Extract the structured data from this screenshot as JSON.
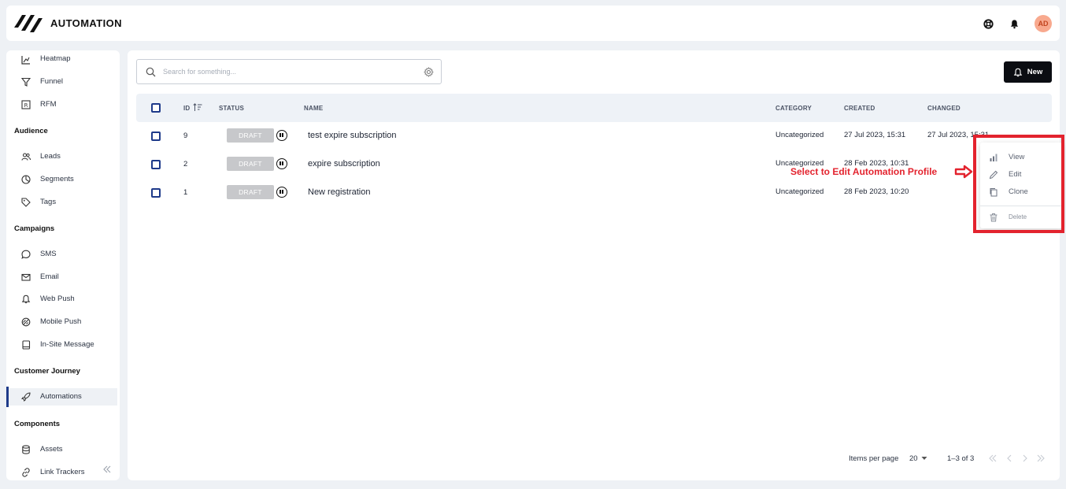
{
  "header": {
    "app_title": "AUTOMATION",
    "avatar_initials": "AD",
    "icons": [
      "lifebuoy-icon",
      "bell-icon"
    ]
  },
  "sidebar": {
    "items_top": [
      {
        "label": "Heatmap",
        "icon": "chart-icon"
      },
      {
        "label": "Funnel",
        "icon": "funnel-icon"
      },
      {
        "label": "RFM",
        "icon": "rfm-icon"
      }
    ],
    "sections": [
      {
        "title": "Audience",
        "items": [
          {
            "label": "Leads",
            "icon": "users-icon"
          },
          {
            "label": "Segments",
            "icon": "pie-icon"
          },
          {
            "label": "Tags",
            "icon": "tag-icon"
          }
        ]
      },
      {
        "title": "Campaigns",
        "items": [
          {
            "label": "SMS",
            "icon": "chat-icon"
          },
          {
            "label": "Email",
            "icon": "mail-icon"
          },
          {
            "label": "Web Push",
            "icon": "bell-icon"
          },
          {
            "label": "Mobile Push",
            "icon": "mobile-push-icon"
          },
          {
            "label": "In-Site Message",
            "icon": "book-icon"
          }
        ]
      },
      {
        "title": "Customer Journey",
        "items": [
          {
            "label": "Automations",
            "icon": "rocket-icon",
            "active": true
          }
        ]
      },
      {
        "title": "Components",
        "items": [
          {
            "label": "Assets",
            "icon": "database-icon"
          },
          {
            "label": "Link Trackers",
            "icon": "link-icon"
          }
        ]
      }
    ]
  },
  "toolbar": {
    "search_placeholder": "Search for something...",
    "new_label": "New"
  },
  "table": {
    "columns": [
      "ID",
      "STATUS",
      "NAME",
      "CATEGORY",
      "CREATED",
      "CHANGED"
    ],
    "rows": [
      {
        "id": "9",
        "status": "DRAFT",
        "name": "test expire subscription",
        "category": "Uncategorized",
        "created": "27 Jul 2023, 15:31",
        "changed": "27 Jul 2023, 15:31"
      },
      {
        "id": "2",
        "status": "DRAFT",
        "name": "expire subscription",
        "category": "Uncategorized",
        "created": "28 Feb 2023, 10:31",
        "changed": ""
      },
      {
        "id": "1",
        "status": "DRAFT",
        "name": "New registration",
        "category": "Uncategorized",
        "created": "28 Feb 2023, 10:20",
        "changed": ""
      }
    ]
  },
  "pagination": {
    "items_per_page_label": "Items per page",
    "items_per_page_value": "20",
    "range": "1–3 of 3"
  },
  "context_menu": {
    "items": [
      {
        "label": "View",
        "icon": "bar-chart-icon"
      },
      {
        "label": "Edit",
        "icon": "pencil-icon"
      },
      {
        "label": "Clone",
        "icon": "copy-icon"
      },
      {
        "label": "Delete",
        "icon": "trash-icon"
      }
    ]
  },
  "annotation": {
    "text": "Select to Edit Automation Profile",
    "color": "#e3232e"
  },
  "colors": {
    "accent": "#1e3a8a",
    "draft_badge": "#c7c8cb",
    "avatar_bg": "#f8a98e",
    "button_dark": "#0b0d12"
  }
}
